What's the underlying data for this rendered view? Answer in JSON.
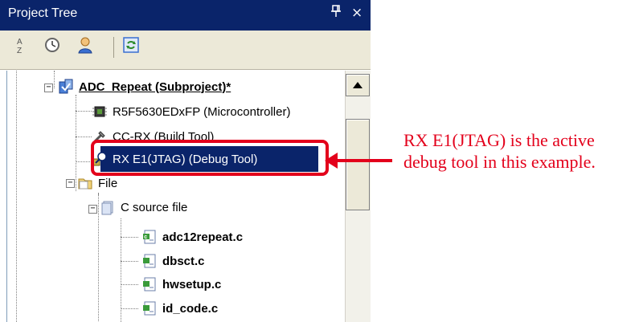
{
  "panel": {
    "title": "Project Tree",
    "pin_glyph": "ὌC",
    "pin_label": "▐",
    "close_label": "×"
  },
  "toolbar": {
    "icons": [
      "sort-az-icon",
      "clock-icon",
      "user-icon",
      "refresh-icon"
    ],
    "sort_glyph_a": "A",
    "sort_glyph_z": "Z"
  },
  "tree": {
    "items": [
      {
        "label": "ADC_Repeat (Subproject)*"
      },
      {
        "label": "R5F5630EDxFP (Microcontroller)"
      },
      {
        "label": "CC-RX (Build Tool)"
      },
      {
        "label": "RX E1(JTAG) (Debug Tool)"
      },
      {
        "label": "File"
      },
      {
        "label": "C source file"
      },
      {
        "label": "adc12repeat.c"
      },
      {
        "label": "dbsct.c"
      },
      {
        "label": "hwsetup.c"
      },
      {
        "label": "id_code.c"
      }
    ]
  },
  "callout": {
    "text": "RX E1(JTAG) is the active debug tool in this example."
  },
  "colors": {
    "titlebar": "#0a246a",
    "selection": "#0a246a",
    "highlight_red": "#e3001b",
    "toolbar_bg": "#ece9d8"
  }
}
